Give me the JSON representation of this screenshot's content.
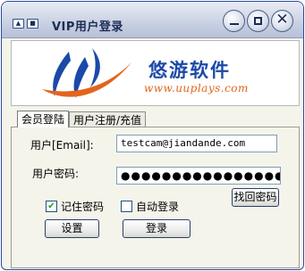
{
  "window": {
    "title": "VIP用户登录"
  },
  "banner": {
    "brand_name": "悠游软件",
    "brand_url": "www.uuplays.com"
  },
  "tabs": [
    {
      "label": "会员登陆",
      "active": true
    },
    {
      "label": "用户注册/充值",
      "active": false
    }
  ],
  "form": {
    "user_label": "用户[Email]:",
    "user_value": "testcam@jiandande.com",
    "password_label": "用户密码:",
    "password_value": "●●●●●●●●●●●●●●●●●●",
    "find_password_button": "找回密码",
    "remember_password_label": "记住密码",
    "remember_password_checked": true,
    "auto_login_label": "自动登录",
    "auto_login_checked": false,
    "settings_button": "设置",
    "login_button": "登录"
  },
  "colors": {
    "brand_blue": "#1b49a8",
    "brand_orange": "#e3641b",
    "title_bar": "#c4ccdf"
  }
}
